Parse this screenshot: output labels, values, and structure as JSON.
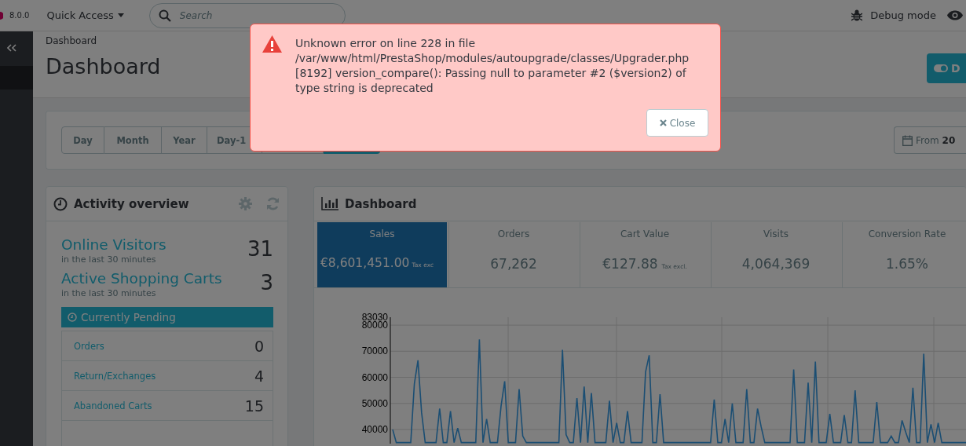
{
  "header": {
    "version": "8.0.0",
    "quick_access": "Quick Access",
    "search": {
      "placeholder": "Search"
    },
    "debug": "Debug mode"
  },
  "breadcrumb": "Dashboard",
  "title": "Dashboard",
  "toolbar_button": "D",
  "filter": {
    "ranges": [
      {
        "label": "Day",
        "selected": false
      },
      {
        "label": "Month",
        "selected": false
      },
      {
        "label": "Year",
        "selected": false
      },
      {
        "label": "Day-1",
        "selected": false
      },
      {
        "selected": false
      },
      {
        "selected": true
      }
    ],
    "date_button": "From **20**"
  },
  "activity": {
    "title": "Activity overview",
    "stats": [
      {
        "label": "Online Visitors",
        "value": "31",
        "sub": "in the last 30 minutes"
      },
      {
        "label": "Active Shopping Carts",
        "value": "3",
        "sub": "in the last 30 minutes"
      }
    ],
    "pending": {
      "title": "Currently Pending",
      "rows": [
        {
          "label": "Orders",
          "value": "0"
        },
        {
          "label": "Return/Exchanges",
          "value": "4"
        },
        {
          "label": "Abandoned Carts",
          "value": "15"
        }
      ]
    }
  },
  "dashboard": {
    "title": "Dashboard",
    "kpis": [
      {
        "label": "Sales",
        "value": "€8,601,451.00",
        "note": "Tax exc",
        "selected": true
      },
      {
        "label": "Orders",
        "value": "67,262",
        "selected": false
      },
      {
        "label": "Cart Value",
        "value": "€127.88",
        "note": "Tax excl.",
        "selected": false
      },
      {
        "label": "Visits",
        "value": "4,064,369",
        "selected": false
      },
      {
        "label": "Conversion Rate",
        "value": "1.65%",
        "selected": false
      }
    ],
    "chart_data": {
      "type": "line",
      "grid": true,
      "ylim": [
        34580,
        83030
      ],
      "yticks": [
        40000,
        50000,
        60000,
        70000,
        80000,
        83030
      ],
      "series": [
        {
          "color": "#1b4e73",
          "values": [
            40000,
            35000,
            35000,
            35000,
            35000,
            35000,
            57500,
            66500,
            46500,
            35000,
            35000,
            35000,
            35000,
            48000,
            35000,
            35000,
            47000,
            35000,
            40500,
            35000,
            35000,
            35000,
            35000,
            35000,
            74500,
            35000,
            44000,
            35000,
            35000,
            35000,
            49000,
            58500,
            35000,
            35000,
            35000,
            55500,
            37500,
            35000,
            35000,
            35000,
            35000,
            35000,
            35000,
            35000,
            35000,
            35000,
            35000,
            70500,
            38000,
            35000,
            35000,
            52000,
            35000,
            56500,
            35000,
            54000,
            35000,
            35000,
            35000,
            35000,
            51000,
            35000,
            42500,
            35000,
            35000,
            47000,
            35000,
            35000,
            35000,
            35000,
            62000,
            68500,
            35000,
            35000,
            53500,
            35000,
            35000,
            35000,
            35000,
            35000,
            35000,
            35000,
            35000,
            35000,
            35000,
            35000,
            35000,
            35000,
            35000,
            51500,
            35000,
            35000,
            44000,
            35000,
            50000,
            35000,
            35000,
            35000,
            55500,
            35000,
            35000,
            48000,
            41000,
            35000,
            35000,
            35000,
            35000,
            35000,
            35000,
            35000,
            35000,
            63000,
            35000,
            35000,
            35000,
            58000,
            35000,
            66000,
            35000,
            35000,
            35000,
            46000,
            35000,
            35000,
            35000,
            45500,
            35000,
            35000,
            55000,
            35000,
            35000,
            35000,
            35000,
            35000,
            50500,
            35000,
            35000,
            35000,
            37500,
            35000,
            35000,
            43500,
            39000,
            35000,
            56000,
            35000,
            35000,
            69000,
            35000,
            42000,
            35000,
            42500,
            35000,
            35000,
            35000,
            35000,
            35000,
            35000,
            35000,
            35000
          ]
        }
      ]
    }
  },
  "dialog": {
    "message": "Unknown error on line 228 in file /var/www/html/PrestaShop/modules/autoupgrade/classes/Upgrader.php [8192] version_compare(): Passing null to parameter #2 ($version2) of type string is deprecated",
    "close": "Close"
  }
}
